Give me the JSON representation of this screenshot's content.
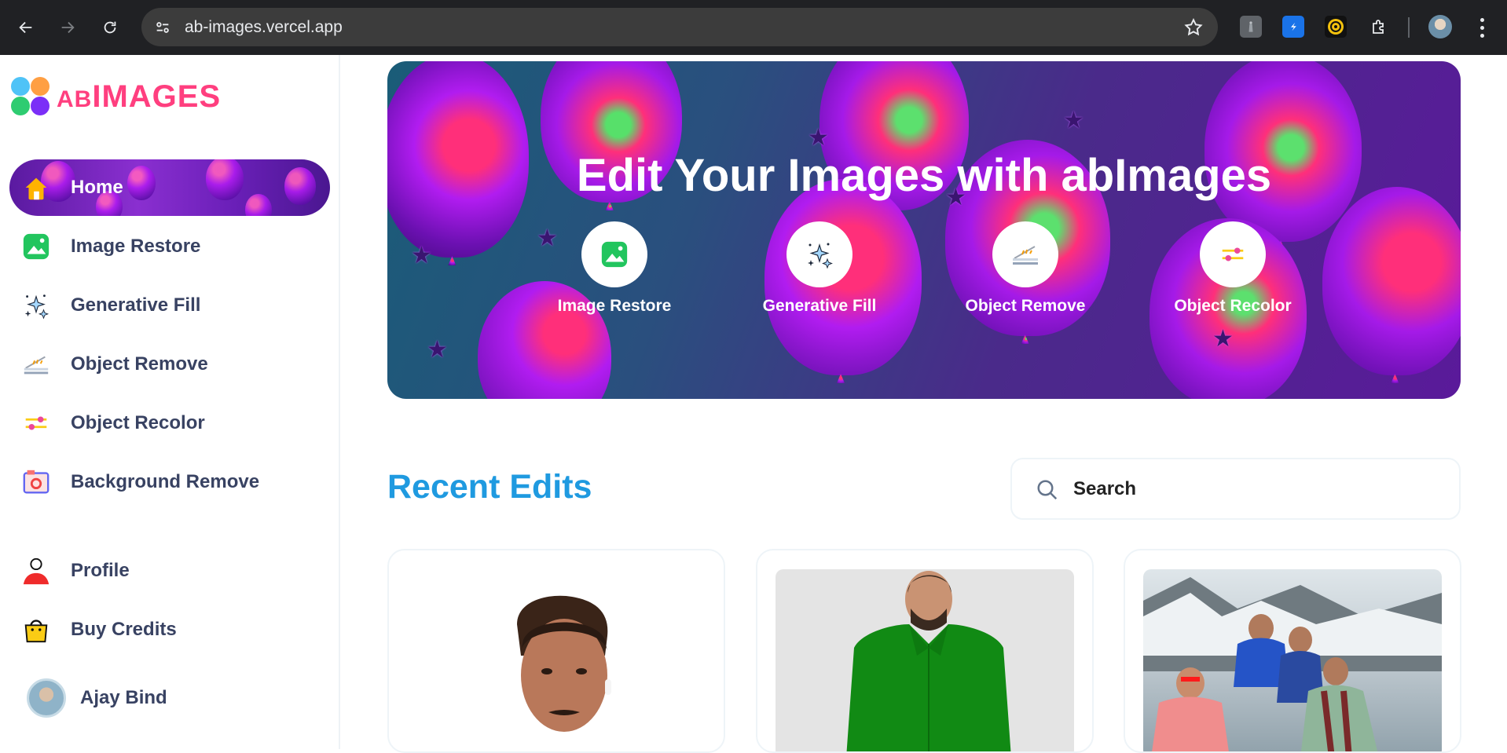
{
  "browser": {
    "url": "ab-images.vercel.app"
  },
  "logo": {
    "prefix": "AB",
    "name": "IMAGES"
  },
  "sidebar": {
    "items": [
      {
        "label": "Home",
        "icon": "home-icon",
        "active": true
      },
      {
        "label": "Image Restore",
        "icon": "image-icon"
      },
      {
        "label": "Generative Fill",
        "icon": "sparkles-icon"
      },
      {
        "label": "Object Remove",
        "icon": "scan-icon"
      },
      {
        "label": "Object Recolor",
        "icon": "filter-icon"
      },
      {
        "label": "Background Remove",
        "icon": "camera-icon"
      }
    ],
    "bottom": [
      {
        "label": "Profile",
        "icon": "profile-icon"
      },
      {
        "label": "Buy Credits",
        "icon": "bag-icon"
      }
    ],
    "user": {
      "name": "Ajay Bind"
    }
  },
  "hero": {
    "title": "Edit Your Images with abImages",
    "tools": [
      {
        "label": "Image Restore",
        "icon": "image-icon"
      },
      {
        "label": "Generative Fill",
        "icon": "sparkles-icon"
      },
      {
        "label": "Object Remove",
        "icon": "scan-icon"
      },
      {
        "label": "Object Recolor",
        "icon": "filter-icon"
      }
    ]
  },
  "recent": {
    "title": "Recent Edits",
    "search_placeholder": "Search"
  },
  "colors": {
    "brand_pink": "#ff3f7f",
    "accent_blue": "#1f9ae0",
    "sidebar_text": "#384262"
  }
}
